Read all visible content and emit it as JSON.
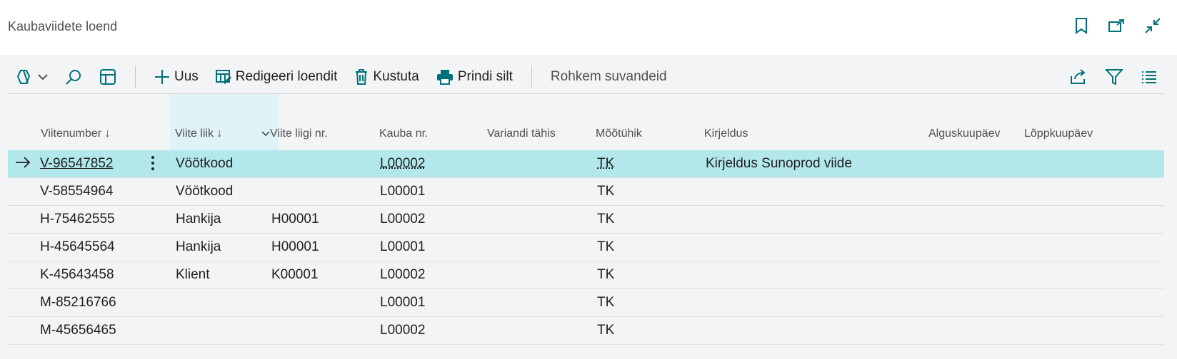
{
  "header": {
    "title": "Kaubaviidete loend"
  },
  "toolbar": {
    "new": "Uus",
    "edit_list": "Redigeeri loendit",
    "delete": "Kustuta",
    "print": "Prindi silt",
    "more": "Rohkem suvandeid"
  },
  "columns": {
    "ref_no": "Viitenumber ↓",
    "ref_type": "Viite liik ↓",
    "ref_type_no": "Viite liigi nr.",
    "item_no": "Kauba nr.",
    "variant": "Variandi tähis",
    "uom": "Mõõtühik",
    "desc": "Kirjeldus",
    "start": "Alguskuupäev",
    "end": "Lõppkuupäev"
  },
  "rows": [
    {
      "ref_no": "V-96547852",
      "ref_type": "Vöötkood",
      "ref_type_no": "",
      "item_no": "L00002",
      "uom": "TK",
      "desc": "Kirjeldus Sunoprod viide"
    },
    {
      "ref_no": "V-58554964",
      "ref_type": "Vöötkood",
      "ref_type_no": "",
      "item_no": "L00001",
      "uom": "TK",
      "desc": ""
    },
    {
      "ref_no": "H-75462555",
      "ref_type": "Hankija",
      "ref_type_no": "H00001",
      "item_no": "L00002",
      "uom": "TK",
      "desc": ""
    },
    {
      "ref_no": "H-45645564",
      "ref_type": "Hankija",
      "ref_type_no": "H00001",
      "item_no": "L00001",
      "uom": "TK",
      "desc": ""
    },
    {
      "ref_no": "K-45643458",
      "ref_type": "Klient",
      "ref_type_no": "K00001",
      "item_no": "L00002",
      "uom": "TK",
      "desc": ""
    },
    {
      "ref_no": "M-85216766",
      "ref_type": "",
      "ref_type_no": "",
      "item_no": "L00001",
      "uom": "TK",
      "desc": ""
    },
    {
      "ref_no": "M-45656465",
      "ref_type": "",
      "ref_type_no": "",
      "item_no": "L00002",
      "uom": "TK",
      "desc": ""
    }
  ],
  "colors": {
    "accent": "#00707a",
    "selected_row": "#b2e8ec",
    "column_highlight": "#dff2f5"
  }
}
